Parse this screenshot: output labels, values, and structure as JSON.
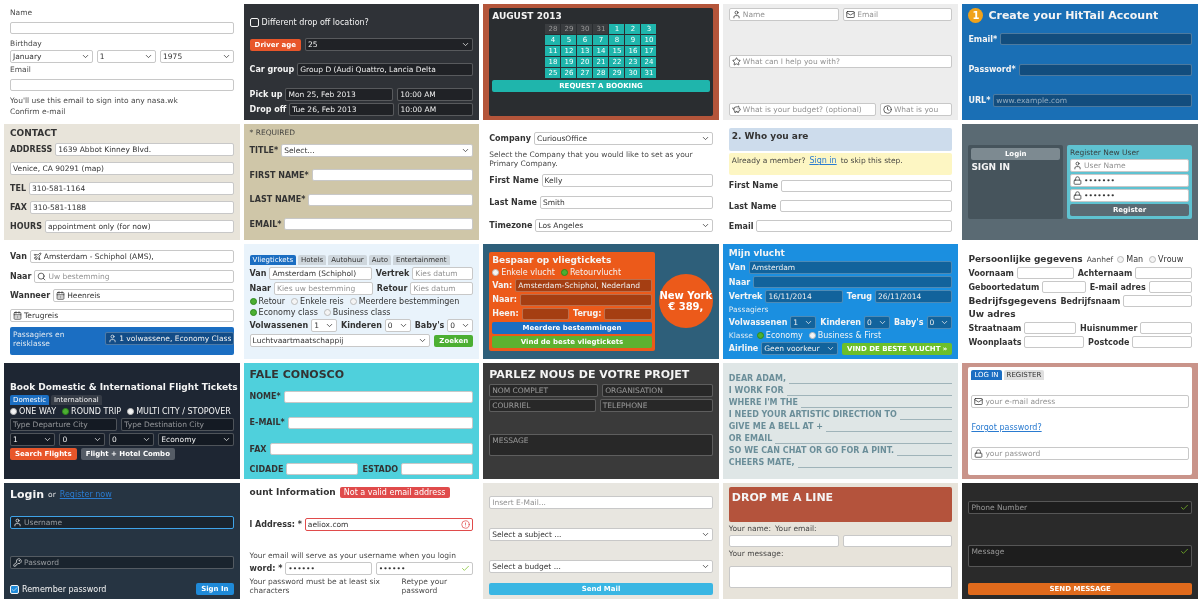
{
  "tiles": [
    {
      "color": "#ffffff",
      "items": [
        {
          "kind": "text",
          "text": "Name"
        },
        {
          "kind": "field"
        },
        {
          "kind": "text",
          "text": "Birthday"
        },
        {
          "kind": "row",
          "items": [
            {
              "kind": "field",
              "value": "January",
              "dropdown": true
            },
            {
              "kind": "field",
              "value": "1",
              "dropdown": true
            },
            {
              "kind": "field",
              "value": "1975",
              "dropdown": true
            }
          ]
        },
        {
          "kind": "text",
          "text": "Email"
        },
        {
          "kind": "field"
        },
        {
          "kind": "text",
          "text": "You'll use this email to sign into any nasa.wk"
        },
        {
          "kind": "text",
          "text": "Confirm e-mail"
        }
      ]
    },
    {
      "color": "#2f3237",
      "items": [
        {
          "kind": "check",
          "label": "Different drop off location?",
          "checked": false
        },
        {
          "kind": "row",
          "items": [
            {
              "kind": "button",
              "label": "Driver age",
              "color": "#e8562a"
            },
            {
              "kind": "field",
              "value": "25",
              "dropdown": true
            }
          ]
        },
        {
          "kind": "field",
          "label": "Car group",
          "value": "Group D (Audi Quattro, Lancia Delta"
        },
        {
          "kind": "row",
          "items": [
            {
              "kind": "field",
              "label": "Pick up",
              "value": "Mon 25, Feb 2013"
            },
            {
              "kind": "field",
              "value": "10:00 AM"
            }
          ]
        },
        {
          "kind": "row",
          "items": [
            {
              "kind": "field",
              "label": "Drop off",
              "value": "Tue 26, Feb 2013"
            },
            {
              "kind": "field",
              "value": "10:00 AM"
            }
          ]
        }
      ]
    },
    {
      "color": "#b4553a",
      "items": [
        {
          "kind": "panel",
          "color": "#2a2d30",
          "items": [
            {
              "kind": "heading",
              "text": "AUGUST 2013"
            },
            {
              "kind": "calendar",
              "days": [
                {
                  "label": "28",
                  "muted": true
                },
                {
                  "label": "29",
                  "muted": true
                },
                {
                  "label": "30",
                  "muted": true
                },
                {
                  "label": "31",
                  "muted": true
                },
                {
                  "label": "1",
                  "muted": false
                },
                {
                  "label": "2",
                  "muted": false
                },
                {
                  "label": "3",
                  "muted": false
                },
                {
                  "label": "4",
                  "muted": false
                },
                {
                  "label": "5",
                  "muted": false
                },
                {
                  "label": "6",
                  "muted": false
                },
                {
                  "label": "7",
                  "muted": false
                },
                {
                  "label": "8",
                  "muted": false
                },
                {
                  "label": "9",
                  "muted": false
                },
                {
                  "label": "10",
                  "muted": false
                },
                {
                  "label": "11",
                  "muted": false
                },
                {
                  "label": "12",
                  "muted": false
                },
                {
                  "label": "13",
                  "muted": false
                },
                {
                  "label": "14",
                  "muted": false
                },
                {
                  "label": "15",
                  "muted": false
                },
                {
                  "label": "16",
                  "muted": false
                },
                {
                  "label": "17",
                  "muted": false
                },
                {
                  "label": "18",
                  "muted": false
                },
                {
                  "label": "19",
                  "muted": false
                },
                {
                  "label": "20",
                  "muted": false
                },
                {
                  "label": "21",
                  "muted": false
                },
                {
                  "label": "22",
                  "muted": false
                },
                {
                  "label": "23",
                  "muted": false
                },
                {
                  "label": "24",
                  "muted": false
                },
                {
                  "label": "25",
                  "muted": false
                },
                {
                  "label": "26",
                  "muted": false
                },
                {
                  "label": "27",
                  "muted": false
                },
                {
                  "label": "28",
                  "muted": false
                },
                {
                  "label": "29",
                  "muted": false
                },
                {
                  "label": "30",
                  "muted": false
                },
                {
                  "label": "31",
                  "muted": false
                }
              ]
            },
            {
              "kind": "button",
              "label": "REQUEST A BOOKING",
              "color": "#1fb5ac"
            }
          ]
        }
      ]
    },
    {
      "color": "#ededed",
      "items": [
        {
          "kind": "row",
          "items": [
            {
              "kind": "person",
              "placeholder": "Name"
            },
            {
              "kind": "mail",
              "placeholder": "Email"
            }
          ]
        },
        {
          "kind": "star",
          "placeholder": "What can I help you with?"
        },
        {
          "kind": "row",
          "items": [
            {
              "kind": "piggy",
              "placeholder": "What is your budget? (optional)"
            },
            {
              "kind": "clock",
              "placeholder": "What is you"
            }
          ]
        }
      ]
    },
    {
      "color": "#1a6fb5",
      "items": [
        {
          "kind": "title",
          "text": "Create your HitTail Account",
          "badge": "1"
        },
        {
          "kind": "field",
          "label": "Email*"
        },
        {
          "kind": "field",
          "label": "Password*"
        },
        {
          "kind": "field",
          "label": "URL*",
          "placeholder": "www.example.com"
        }
      ]
    },
    {
      "color": "#e8e4da",
      "items": [
        {
          "kind": "heading",
          "text": "CONTACT"
        },
        {
          "kind": "field",
          "label": "ADDRESS",
          "value": "1639 Abbot Kinney Blvd."
        },
        {
          "kind": "field",
          "value": "Venice, CA 90291 (map)"
        },
        {
          "kind": "field",
          "label": "TEL",
          "value": "310-581-1164"
        },
        {
          "kind": "field",
          "label": "FAX",
          "value": "310-581-1188"
        },
        {
          "kind": "field",
          "label": "HOURS",
          "value": "appointment only (for now)"
        }
      ]
    },
    {
      "color": "#cfc6a8",
      "items": [
        {
          "kind": "text",
          "text": "* REQUIRED"
        },
        {
          "kind": "field",
          "label": "TITLE*",
          "value": "Select...",
          "dropdown": true
        },
        {
          "kind": "field",
          "label": "FIRST NAME*"
        },
        {
          "kind": "field",
          "label": "LAST NAME*"
        },
        {
          "kind": "field",
          "label": "EMAIL*"
        }
      ]
    },
    {
      "color": "#ffffff",
      "items": [
        {
          "kind": "field",
          "label": "Company",
          "value": "CuriousOffice",
          "dropdown": true
        },
        {
          "kind": "text",
          "text": "Select the Company that you would like to set as your Primary Company."
        },
        {
          "kind": "field",
          "label": "First Name",
          "value": "Kelly"
        },
        {
          "kind": "field",
          "label": "Last Name",
          "value": "Smith"
        },
        {
          "kind": "field",
          "label": "Timezone",
          "value": "Los Angeles",
          "dropdown": true
        }
      ]
    },
    {
      "color": "#ffffff",
      "items": [
        {
          "kind": "panel",
          "color": "#cddcec",
          "items": [
            {
              "kind": "heading",
              "text": "2. Who you are"
            }
          ]
        },
        {
          "kind": "panel",
          "color": "#fdf6c3",
          "items": [
            {
              "kind": "row",
              "items": [
                {
                  "kind": "text",
                  "text": "Already a member?"
                },
                {
                  "kind": "link",
                  "text": "Sign in"
                },
                {
                  "kind": "text",
                  "text": "to skip this step."
                }
              ]
            }
          ]
        },
        {
          "kind": "field",
          "label": "First Name"
        },
        {
          "kind": "field",
          "label": "Last Name"
        },
        {
          "kind": "field",
          "label": "Email"
        }
      ]
    },
    {
      "color": "#5a6a73",
      "items": [
        {
          "kind": "row",
          "items": [
            {
              "kind": "panel",
              "color": "#46545c",
              "items": [
                {
                  "kind": "button",
                  "label": "Login",
                  "color": "#7d8a91"
                },
                {
                  "kind": "heading",
                  "text": "SIGN IN"
                }
              ]
            },
            {
              "kind": "panel",
              "color": "#5fc2d1",
              "items": [
                {
                  "kind": "text",
                  "text": "Register New User"
                },
                {
                  "kind": "person",
                  "placeholder": "User Name"
                },
                {
                  "kind": "lock",
                  "value": "•••••••"
                },
                {
                  "kind": "lock",
                  "value": "•••••••"
                },
                {
                  "kind": "button",
                  "label": "Register",
                  "color": "#5a6a73"
                }
              ]
            }
          ]
        }
      ]
    },
    {
      "color": "#ffffff",
      "items": [
        {
          "kind": "plane",
          "label": "Van",
          "value": "Amsterdam - Schiphol (AMS),"
        },
        {
          "kind": "search",
          "label": "Naar",
          "placeholder": "Uw bestemming"
        },
        {
          "kind": "date",
          "label": "Wanneer",
          "value": "Heenreis"
        },
        {
          "kind": "date",
          "value": "Terugreis"
        },
        {
          "kind": "panel",
          "color": "#1b6ec2",
          "items": [
            {
              "kind": "row",
              "items": [
                {
                  "kind": "text",
                  "text": "Passagiers en reisklasse"
                },
                {
                  "kind": "person",
                  "value": "1 volwassene, Economy Class"
                }
              ]
            }
          ]
        }
      ]
    },
    {
      "color": "#e9f3fb",
      "items": [
        {
          "kind": "tabs",
          "tabs": [
            {
              "label": "Vliegtickets",
              "selected": true
            },
            {
              "label": "Hotels",
              "selected": false
            },
            {
              "label": "Autohuur",
              "selected": false
            },
            {
              "label": "Auto",
              "selected": false
            },
            {
              "label": "Entertainment",
              "selected": false
            }
          ]
        },
        {
          "kind": "row",
          "items": [
            {
              "kind": "field",
              "label": "Van",
              "value": "Amsterdam (Schiphol)"
            },
            {
              "kind": "field",
              "label": "Vertrek",
              "placeholder": "Kies datum"
            }
          ]
        },
        {
          "kind": "row",
          "items": [
            {
              "kind": "field",
              "label": "Naar",
              "placeholder": "Kies uw bestemming"
            },
            {
              "kind": "field",
              "label": "Retour",
              "placeholder": "Kies datum"
            }
          ]
        },
        {
          "kind": "radios",
          "options": [
            {
              "label": "Retour",
              "selected": true
            },
            {
              "label": "Enkele reis",
              "selected": false
            },
            {
              "label": "Meerdere bestemmingen",
              "selected": false
            }
          ]
        },
        {
          "kind": "radios",
          "options": [
            {
              "label": "Economy class",
              "selected": true
            },
            {
              "label": "Business class",
              "selected": false
            }
          ]
        },
        {
          "kind": "row",
          "items": [
            {
              "kind": "field",
              "label": "Volwassenen",
              "value": "1",
              "dropdown": true
            },
            {
              "kind": "field",
              "label": "Kinderen",
              "value": "0",
              "dropdown": true
            },
            {
              "kind": "field",
              "label": "Baby's",
              "value": "0",
              "dropdown": true
            }
          ]
        },
        {
          "kind": "row",
          "items": [
            {
              "kind": "field",
              "value": "Luchtvaartmaatschappij",
              "dropdown": true
            },
            {
              "kind": "button",
              "label": "Zoeken",
              "color": "#4caf32"
            }
          ]
        }
      ]
    },
    {
      "color": "#2e5f7a",
      "items": [
        {
          "kind": "row",
          "items": [
            {
              "kind": "panel",
              "color": "#ec5a1a",
              "items": [
                {
                  "kind": "heading",
                  "text": "Bespaar op vliegtickets"
                },
                {
                  "kind": "radios",
                  "options": [
                    {
                      "label": "Enkele vlucht",
                      "selected": false
                    },
                    {
                      "label": "Retourvlucht",
                      "selected": true
                    }
                  ]
                },
                {
                  "kind": "field",
                  "label": "Van:",
                  "value": "Amsterdam-Schiphol, Nederland"
                },
                {
                  "kind": "field",
                  "label": "Naar:"
                },
                {
                  "kind": "row",
                  "items": [
                    {
                      "kind": "field",
                      "label": "Heen:"
                    },
                    {
                      "kind": "field",
                      "label": "Terug:"
                    }
                  ]
                },
                {
                  "kind": "button",
                  "label": "Meerdere bestemmingen",
                  "color": "#1b6ec2"
                },
                {
                  "kind": "button",
                  "label": "Vind de beste vliegtickets",
                  "color": "#5db230"
                }
              ]
            },
            {
              "kind": "bubble",
              "color": "#ec5a1a",
              "lines": [
                "New York",
                "€ 389,"
              ]
            }
          ]
        }
      ]
    },
    {
      "color": "#1b8fe0",
      "items": [
        {
          "kind": "heading",
          "text": "Mijn vlucht"
        },
        {
          "kind": "field",
          "label": "Van",
          "value": "Amsterdam"
        },
        {
          "kind": "field",
          "label": "Naar"
        },
        {
          "kind": "row",
          "items": [
            {
              "kind": "field",
              "label": "Vertrek",
              "value": "16/11/2014"
            },
            {
              "kind": "field",
              "label": "Terug",
              "value": "26/11/2014"
            }
          ]
        },
        {
          "kind": "text",
          "text": "Passagiers"
        },
        {
          "kind": "row",
          "items": [
            {
              "kind": "field",
              "label": "Volwassenen",
              "value": "1",
              "dropdown": true
            },
            {
              "kind": "field",
              "label": "Kinderen",
              "value": "0",
              "dropdown": true
            },
            {
              "kind": "field",
              "label": "Baby's",
              "value": "0",
              "dropdown": true
            }
          ]
        },
        {
          "kind": "row",
          "items": [
            {
              "kind": "text",
              "text": "Klasse"
            },
            {
              "kind": "radios",
              "options": [
                {
                  "label": "Economy",
                  "selected": true
                },
                {
                  "label": "Business & First",
                  "selected": false
                }
              ]
            }
          ]
        },
        {
          "kind": "row",
          "items": [
            {
              "kind": "field",
              "label": "Airline",
              "value": "Geen voorkeur",
              "dropdown": true
            },
            {
              "kind": "button",
              "label": "VIND DE BESTE VLUCHT »",
              "color": "#6cbf2a"
            }
          ]
        }
      ]
    },
    {
      "color": "#ffffff",
      "items": [
        {
          "kind": "row",
          "items": [
            {
              "kind": "heading",
              "text": "Persoonlijke gegevens"
            },
            {
              "kind": "text",
              "text": "Aanhef"
            },
            {
              "kind": "radios",
              "options": [
                {
                  "label": "Man",
                  "selected": false
                },
                {
                  "label": "Vrouw",
                  "selected": false
                }
              ]
            }
          ]
        },
        {
          "kind": "row",
          "items": [
            {
              "kind": "field",
              "label": "Voornaam"
            },
            {
              "kind": "field",
              "label": "Achternaam"
            }
          ]
        },
        {
          "kind": "row",
          "items": [
            {
              "kind": "field",
              "label": "Geboortedatum"
            },
            {
              "kind": "field",
              "label": "E-mail adres"
            }
          ]
        },
        {
          "kind": "row",
          "items": [
            {
              "kind": "heading",
              "text": "Bedrijfsgegevens"
            },
            {
              "kind": "field",
              "label": "Bedrijfsnaam"
            }
          ]
        },
        {
          "kind": "heading",
          "text": "Uw adres"
        },
        {
          "kind": "row",
          "items": [
            {
              "kind": "field",
              "label": "Straatnaam"
            },
            {
              "kind": "field",
              "label": "Huisnummer"
            }
          ]
        },
        {
          "kind": "row",
          "items": [
            {
              "kind": "field",
              "label": "Woonplaats"
            },
            {
              "kind": "field",
              "label": "Postcode"
            }
          ]
        }
      ]
    },
    {
      "color": "#1e2633",
      "items": [
        {
          "kind": "heading",
          "text": "Book Domestic & International Flight Tickets"
        },
        {
          "kind": "tabs",
          "tabs": [
            {
              "label": "Domestic",
              "selected": true
            },
            {
              "label": "International",
              "selected": false
            }
          ]
        },
        {
          "kind": "radios",
          "options": [
            {
              "label": "ONE WAY",
              "selected": false
            },
            {
              "label": "ROUND TRIP",
              "selected": true
            },
            {
              "label": "MULTI CITY / STOPOVER",
              "selected": false
            }
          ]
        },
        {
          "kind": "row",
          "items": [
            {
              "kind": "field",
              "placeholder": "Type Departure City"
            },
            {
              "kind": "field",
              "placeholder": "Type Destination City"
            }
          ]
        },
        {
          "kind": "row",
          "items": [
            {
              "kind": "field",
              "value": "1",
              "dropdown": true
            },
            {
              "kind": "field",
              "value": "0",
              "dropdown": true
            },
            {
              "kind": "field",
              "value": "0",
              "dropdown": true
            },
            {
              "kind": "field",
              "value": "Economy",
              "dropdown": true
            }
          ]
        },
        {
          "kind": "row",
          "items": [
            {
              "kind": "button",
              "label": "Search Flights",
              "color": "#e8562a"
            },
            {
              "kind": "button",
              "label": "Flight + Hotel Combo",
              "color": "#555c66"
            }
          ]
        }
      ]
    },
    {
      "color": "#4fd0dc",
      "items": [
        {
          "kind": "title",
          "text": "FALE CONOSCO"
        },
        {
          "kind": "field",
          "label": "NOME*"
        },
        {
          "kind": "field",
          "label": "E-MAIL*"
        },
        {
          "kind": "field",
          "label": "FAX"
        },
        {
          "kind": "row",
          "items": [
            {
              "kind": "field",
              "label": "CIDADE"
            },
            {
              "kind": "field",
              "label": "ESTADO"
            }
          ]
        }
      ]
    },
    {
      "color": "#3a3a3a",
      "items": [
        {
          "kind": "title",
          "text": "PARLEZ NOUS DE VOTRE PROJET"
        },
        {
          "kind": "row",
          "items": [
            {
              "kind": "field",
              "placeholder": "NOM COMPLET"
            },
            {
              "kind": "field",
              "placeholder": "ORGANISATION"
            }
          ]
        },
        {
          "kind": "row",
          "items": [
            {
              "kind": "field",
              "placeholder": "COURRIEL"
            },
            {
              "kind": "field",
              "placeholder": "TELEPHONE"
            }
          ]
        },
        {
          "kind": "field",
          "placeholder": "MESSAGE",
          "multiline": true
        }
      ]
    },
    {
      "color": "#dfe6e6",
      "items": [
        {
          "kind": "blank",
          "text": "DEAR ADAM,"
        },
        {
          "kind": "blank",
          "text": "I WORK FOR"
        },
        {
          "kind": "blank",
          "text": "WHERE I'M THE"
        },
        {
          "kind": "blank",
          "text": "I NEED YOUR ARTISTIC DIRECTION TO"
        },
        {
          "kind": "blank",
          "text": "GIVE ME A BELL AT +"
        },
        {
          "kind": "blank",
          "text": "OR EMAIL"
        },
        {
          "kind": "blank",
          "text": "SO WE CAN CHAT OR GO FOR A PINT."
        },
        {
          "kind": "blank",
          "text": "CHEERS MATE,"
        }
      ]
    },
    {
      "color": "#c9948a",
      "items": [
        {
          "kind": "panel",
          "color": "#ffffff",
          "items": [
            {
              "kind": "tabs",
              "tabs": [
                {
                  "label": "LOG IN",
                  "selected": true
                },
                {
                  "label": "REGISTER",
                  "selected": false
                }
              ]
            },
            {
              "kind": "mail",
              "placeholder": "your e-mail adress"
            },
            {
              "kind": "link",
              "text": "Forgot password?"
            },
            {
              "kind": "lock",
              "placeholder": "your password"
            }
          ]
        }
      ]
    },
    {
      "color": "#263442",
      "items": [
        {
          "kind": "row",
          "items": [
            {
              "kind": "title",
              "text": "Login"
            },
            {
              "kind": "text",
              "text": "or"
            },
            {
              "kind": "link",
              "text": "Register now"
            }
          ]
        },
        {
          "kind": "person",
          "placeholder": "Username",
          "focused": true
        },
        {
          "kind": "key",
          "placeholder": "Password"
        },
        {
          "kind": "row",
          "items": [
            {
              "kind": "check",
              "label": "Remember password",
              "checked": true
            },
            {
              "kind": "button",
              "label": "Sign In",
              "color": "#1f8ad8"
            }
          ]
        }
      ]
    },
    {
      "color": "#ffffff",
      "items": [
        {
          "kind": "row",
          "items": [
            {
              "kind": "heading",
              "text": "ount Information"
            },
            {
              "kind": "tooltip",
              "text": "Not a valid email address"
            }
          ]
        },
        {
          "kind": "field",
          "label": "l Address: *",
          "value": "aeliox.com",
          "invalid": true
        },
        {
          "kind": "text",
          "text": "Your email will serve as your username when you login"
        },
        {
          "kind": "row",
          "items": [
            {
              "kind": "field",
              "label": "word: *",
              "value": "••••••"
            },
            {
              "kind": "field",
              "value": "••••••",
              "valid": true
            }
          ]
        },
        {
          "kind": "row",
          "items": [
            {
              "kind": "text",
              "text": "Your password must be at least six characters"
            },
            {
              "kind": "text",
              "text": "Retype your password"
            }
          ]
        }
      ]
    },
    {
      "color": "#e8e6e0",
      "items": [
        {
          "kind": "field",
          "placeholder": "Insert E-Mail..."
        },
        {
          "kind": "field",
          "value": "Select a subject ...",
          "dropdown": true
        },
        {
          "kind": "field",
          "value": "Select a budget ...",
          "dropdown": true
        },
        {
          "kind": "button",
          "label": "Send Mail",
          "color": "#3ab6e3"
        }
      ]
    },
    {
      "color": "#e7e3da",
      "items": [
        {
          "kind": "panel",
          "color": "#b4533c",
          "items": [
            {
              "kind": "title",
              "text": "DROP ME A LINE"
            }
          ]
        },
        {
          "kind": "row",
          "items": [
            {
              "kind": "text",
              "text": "Your name:"
            },
            {
              "kind": "text",
              "text": "Your email:"
            }
          ]
        },
        {
          "kind": "row",
          "items": [
            {
              "kind": "field"
            },
            {
              "kind": "field"
            }
          ]
        },
        {
          "kind": "text",
          "text": "Your message:"
        },
        {
          "kind": "field",
          "multiline": true
        }
      ]
    },
    {
      "color": "#2a2a2a",
      "items": [
        {
          "kind": "field",
          "placeholder": "Phone Number",
          "valid": true
        },
        {
          "kind": "field",
          "placeholder": "Message",
          "valid": true,
          "multiline": true
        },
        {
          "kind": "button",
          "label": "SEND MESSAGE",
          "color": "#e06a1c"
        }
      ]
    }
  ]
}
